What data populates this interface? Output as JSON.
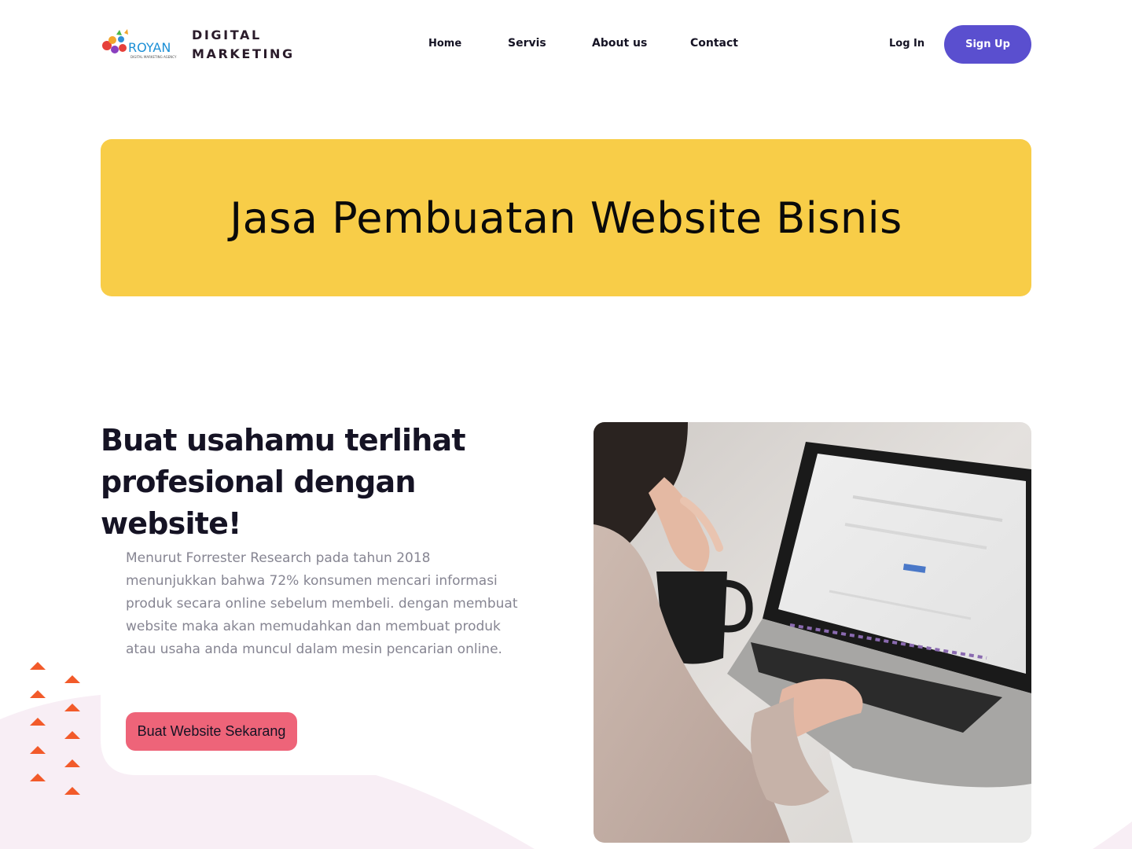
{
  "header": {
    "logo": {
      "brand_mark_text": "ROYAN",
      "brand_mark_subtext": "DIGITAL MARKETING AGENCY",
      "line1": "DIGITAL",
      "line2": "MARKETING"
    },
    "nav": [
      {
        "label": "Home"
      },
      {
        "label": "Servis"
      },
      {
        "label": "About us"
      },
      {
        "label": "Contact"
      }
    ],
    "login_label": "Log In",
    "signup_label": "Sign Up"
  },
  "banner": {
    "title": "Jasa Pembuatan Website Bisnis"
  },
  "main": {
    "headline_line1": "Buat usahamu terlihat",
    "headline_line2": "profesional dengan website!",
    "body": "Menurut Forrester Research pada tahun 2018 menunjukkan bahwa 72% konsumen mencari informasi produk secara online sebelum membeli. dengan membuat website maka akan memudahkan dan membuat produk atau usaha anda muncul dalam mesin pencarian online.",
    "cta_label": "Buat Website Sekarang",
    "photo_icon": "person-typing-on-laptop-photo"
  },
  "colors": {
    "accent": "#5a4fcf",
    "banner": "#f8cd48",
    "cta": "#ee6479",
    "triangles": "#f25a2a",
    "blob": "#f8eef5",
    "body_text": "#868592"
  }
}
